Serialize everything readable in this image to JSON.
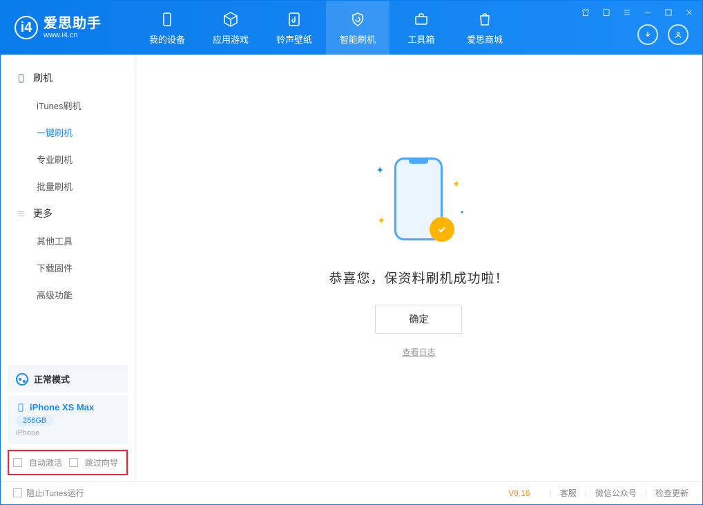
{
  "app": {
    "name": "爱思助手",
    "url": "www.i4.cn"
  },
  "titlebar_icons": [
    "shirt-icon",
    "cube-icon",
    "menu-icon",
    "minimize-icon",
    "maximize-icon",
    "close-icon"
  ],
  "nav": [
    {
      "label": "我的设备",
      "icon": "device-icon"
    },
    {
      "label": "应用游戏",
      "icon": "cube-icon"
    },
    {
      "label": "铃声壁纸",
      "icon": "music-file-icon"
    },
    {
      "label": "智能刷机",
      "icon": "refresh-shield-icon",
      "active": true
    },
    {
      "label": "工具箱",
      "icon": "toolbox-icon"
    },
    {
      "label": "爱思商城",
      "icon": "shop-icon"
    }
  ],
  "sidebar": {
    "group1": {
      "title": "刷机",
      "items": [
        "iTunes刷机",
        "一键刷机",
        "专业刷机",
        "批量刷机"
      ],
      "activeIndex": 1
    },
    "group2": {
      "title": "更多",
      "items": [
        "其他工具",
        "下载固件",
        "高级功能"
      ]
    },
    "mode": "正常模式",
    "device": {
      "name": "iPhone XS Max",
      "storage": "256GB",
      "type": "iPhone"
    },
    "checkboxes": {
      "autoActivate": "自动激活",
      "skipGuide": "跳过向导"
    }
  },
  "main": {
    "message": "恭喜您，保资料刷机成功啦！",
    "okButton": "确定",
    "logLink": "查看日志"
  },
  "footer": {
    "blockiTunes": "阻止iTunes运行",
    "version": "V8.16",
    "links": [
      "客服",
      "微信公众号",
      "检查更新"
    ]
  }
}
